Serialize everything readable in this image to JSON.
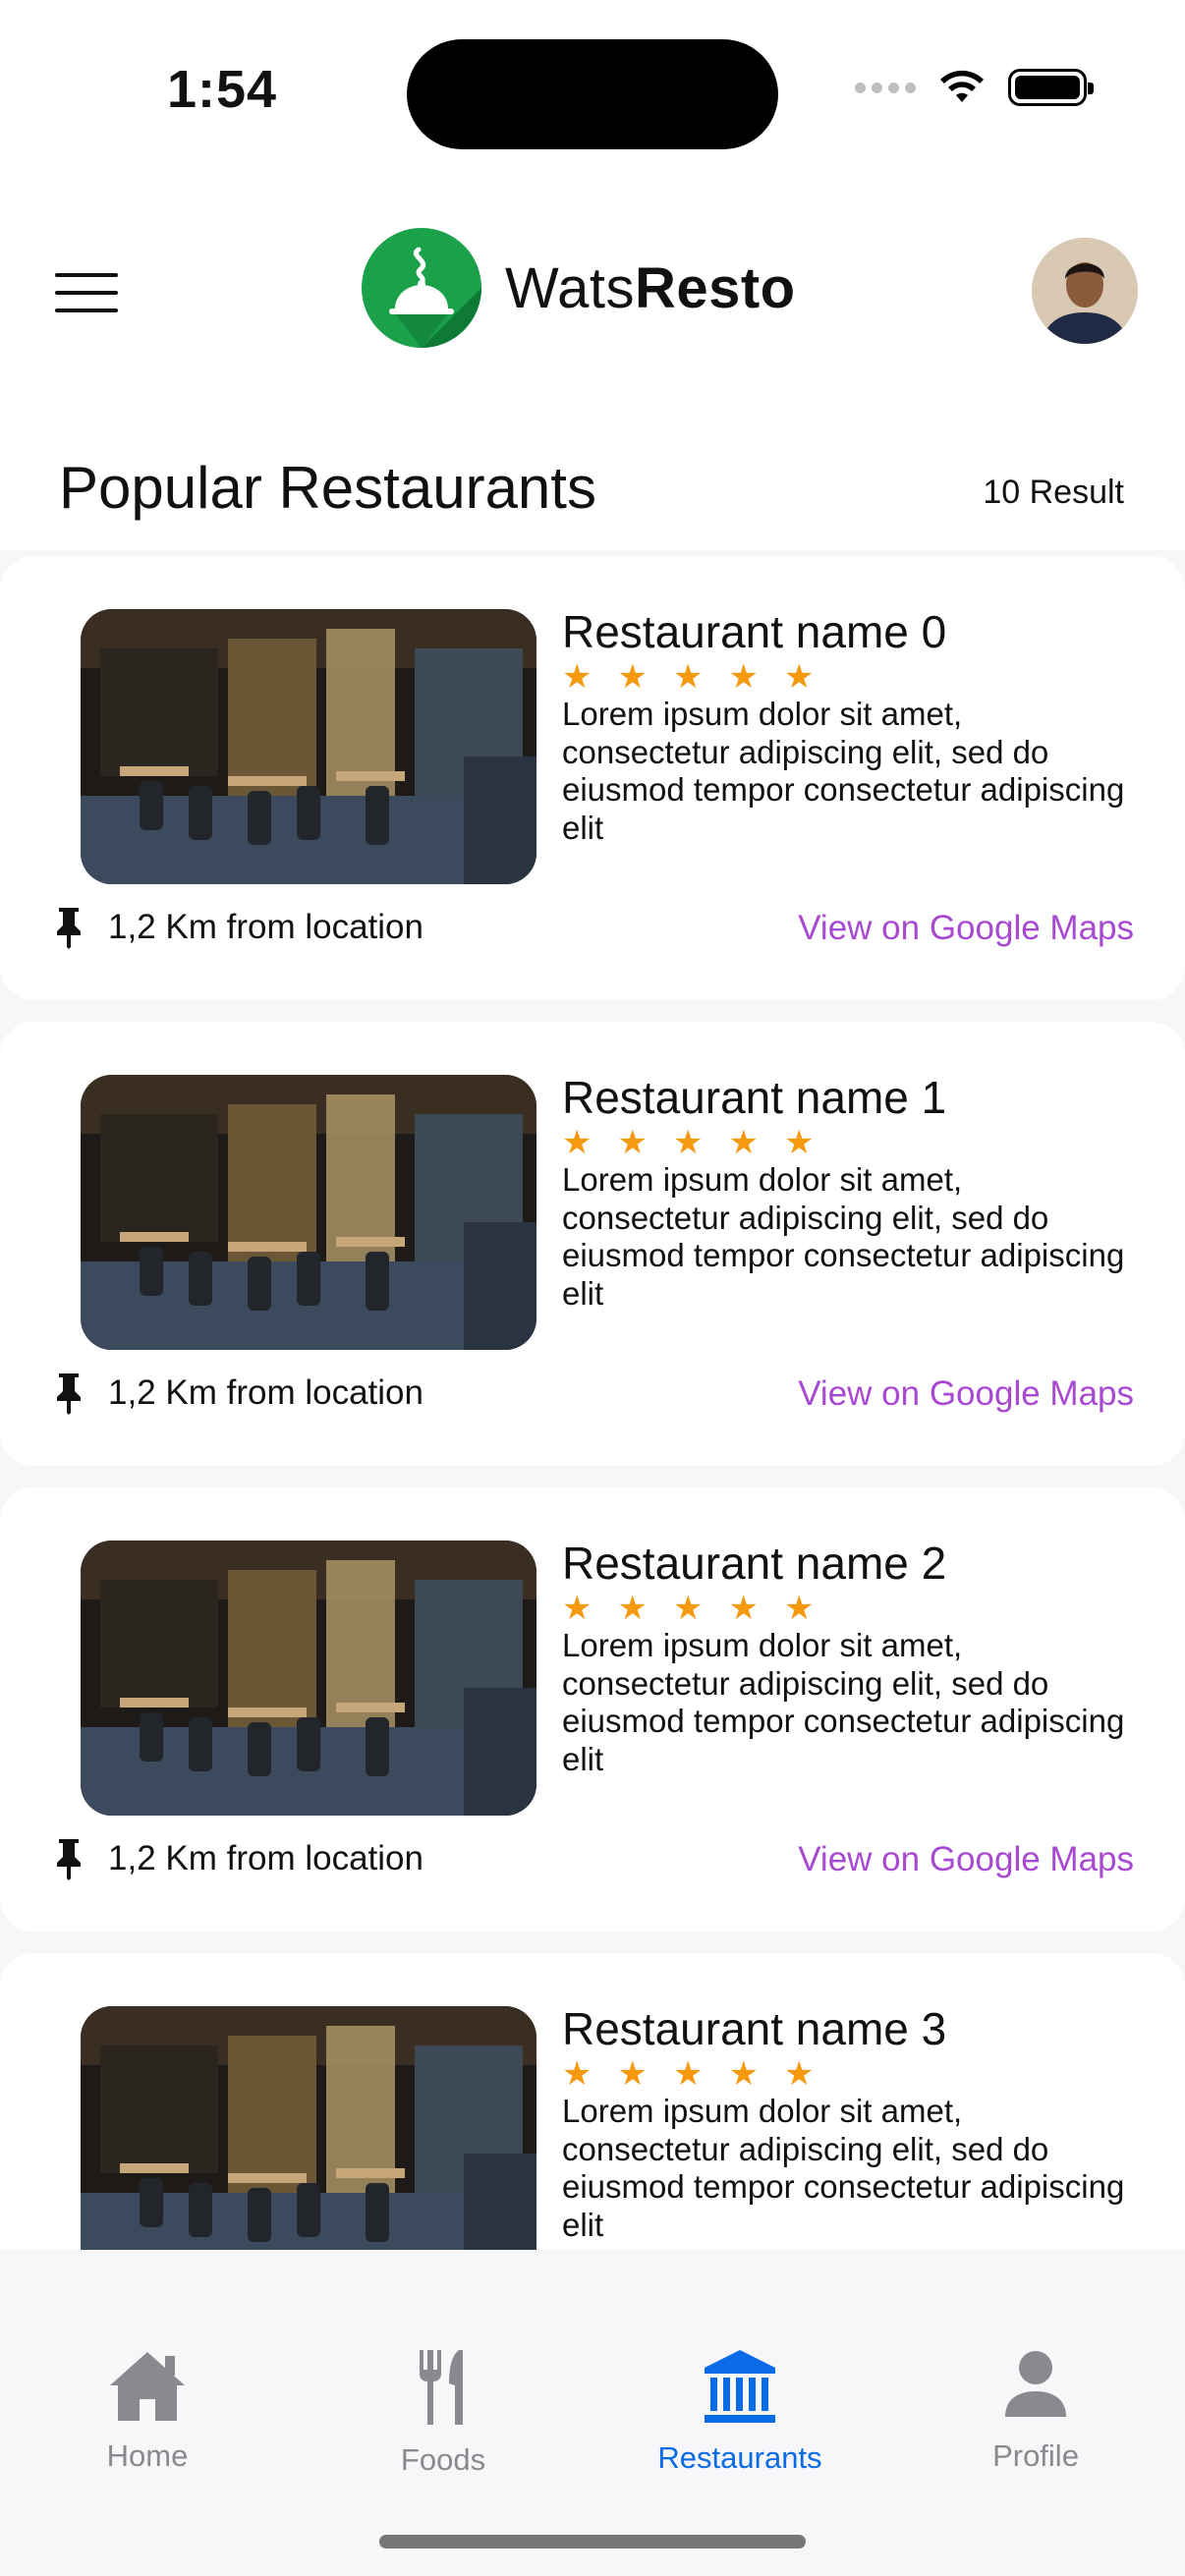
{
  "status_bar": {
    "time": "1:54"
  },
  "header": {
    "brand_light": "Wats",
    "brand_bold": "Resto"
  },
  "section": {
    "title": "Popular Restaurants",
    "result_count": "10 Result"
  },
  "restaurants": [
    {
      "name": "Restaurant name 0",
      "rating": 5,
      "description": "Lorem ipsum dolor sit amet, consectetur adipiscing elit, sed do eiusmod tempor consectetur adipiscing elit",
      "distance": "1,2 Km from location",
      "map_link": "View on Google Maps"
    },
    {
      "name": "Restaurant name 1",
      "rating": 5,
      "description": "Lorem ipsum dolor sit amet, consectetur adipiscing elit, sed do eiusmod tempor consectetur adipiscing elit",
      "distance": "1,2 Km from location",
      "map_link": "View on Google Maps"
    },
    {
      "name": "Restaurant name 2",
      "rating": 5,
      "description": "Lorem ipsum dolor sit amet, consectetur adipiscing elit, sed do eiusmod tempor consectetur adipiscing elit",
      "distance": "1,2 Km from location",
      "map_link": "View on Google Maps"
    },
    {
      "name": "Restaurant name 3",
      "rating": 5,
      "description": "Lorem ipsum dolor sit amet, consectetur adipiscing elit, sed do eiusmod tempor consectetur adipiscing elit",
      "distance": "",
      "map_link": ""
    }
  ],
  "tabs": [
    {
      "label": "Home",
      "icon": "home-icon",
      "active": false
    },
    {
      "label": "Foods",
      "icon": "fork-knife-icon",
      "active": false
    },
    {
      "label": "Restaurants",
      "icon": "bank-icon",
      "active": true
    },
    {
      "label": "Profile",
      "icon": "person-icon",
      "active": false
    }
  ],
  "colors": {
    "accent": "#0a6be6",
    "brand": "#1aa14a",
    "star": "#f59a0f",
    "link": "#a849d1",
    "inactive_tab": "#8a8a8e"
  }
}
